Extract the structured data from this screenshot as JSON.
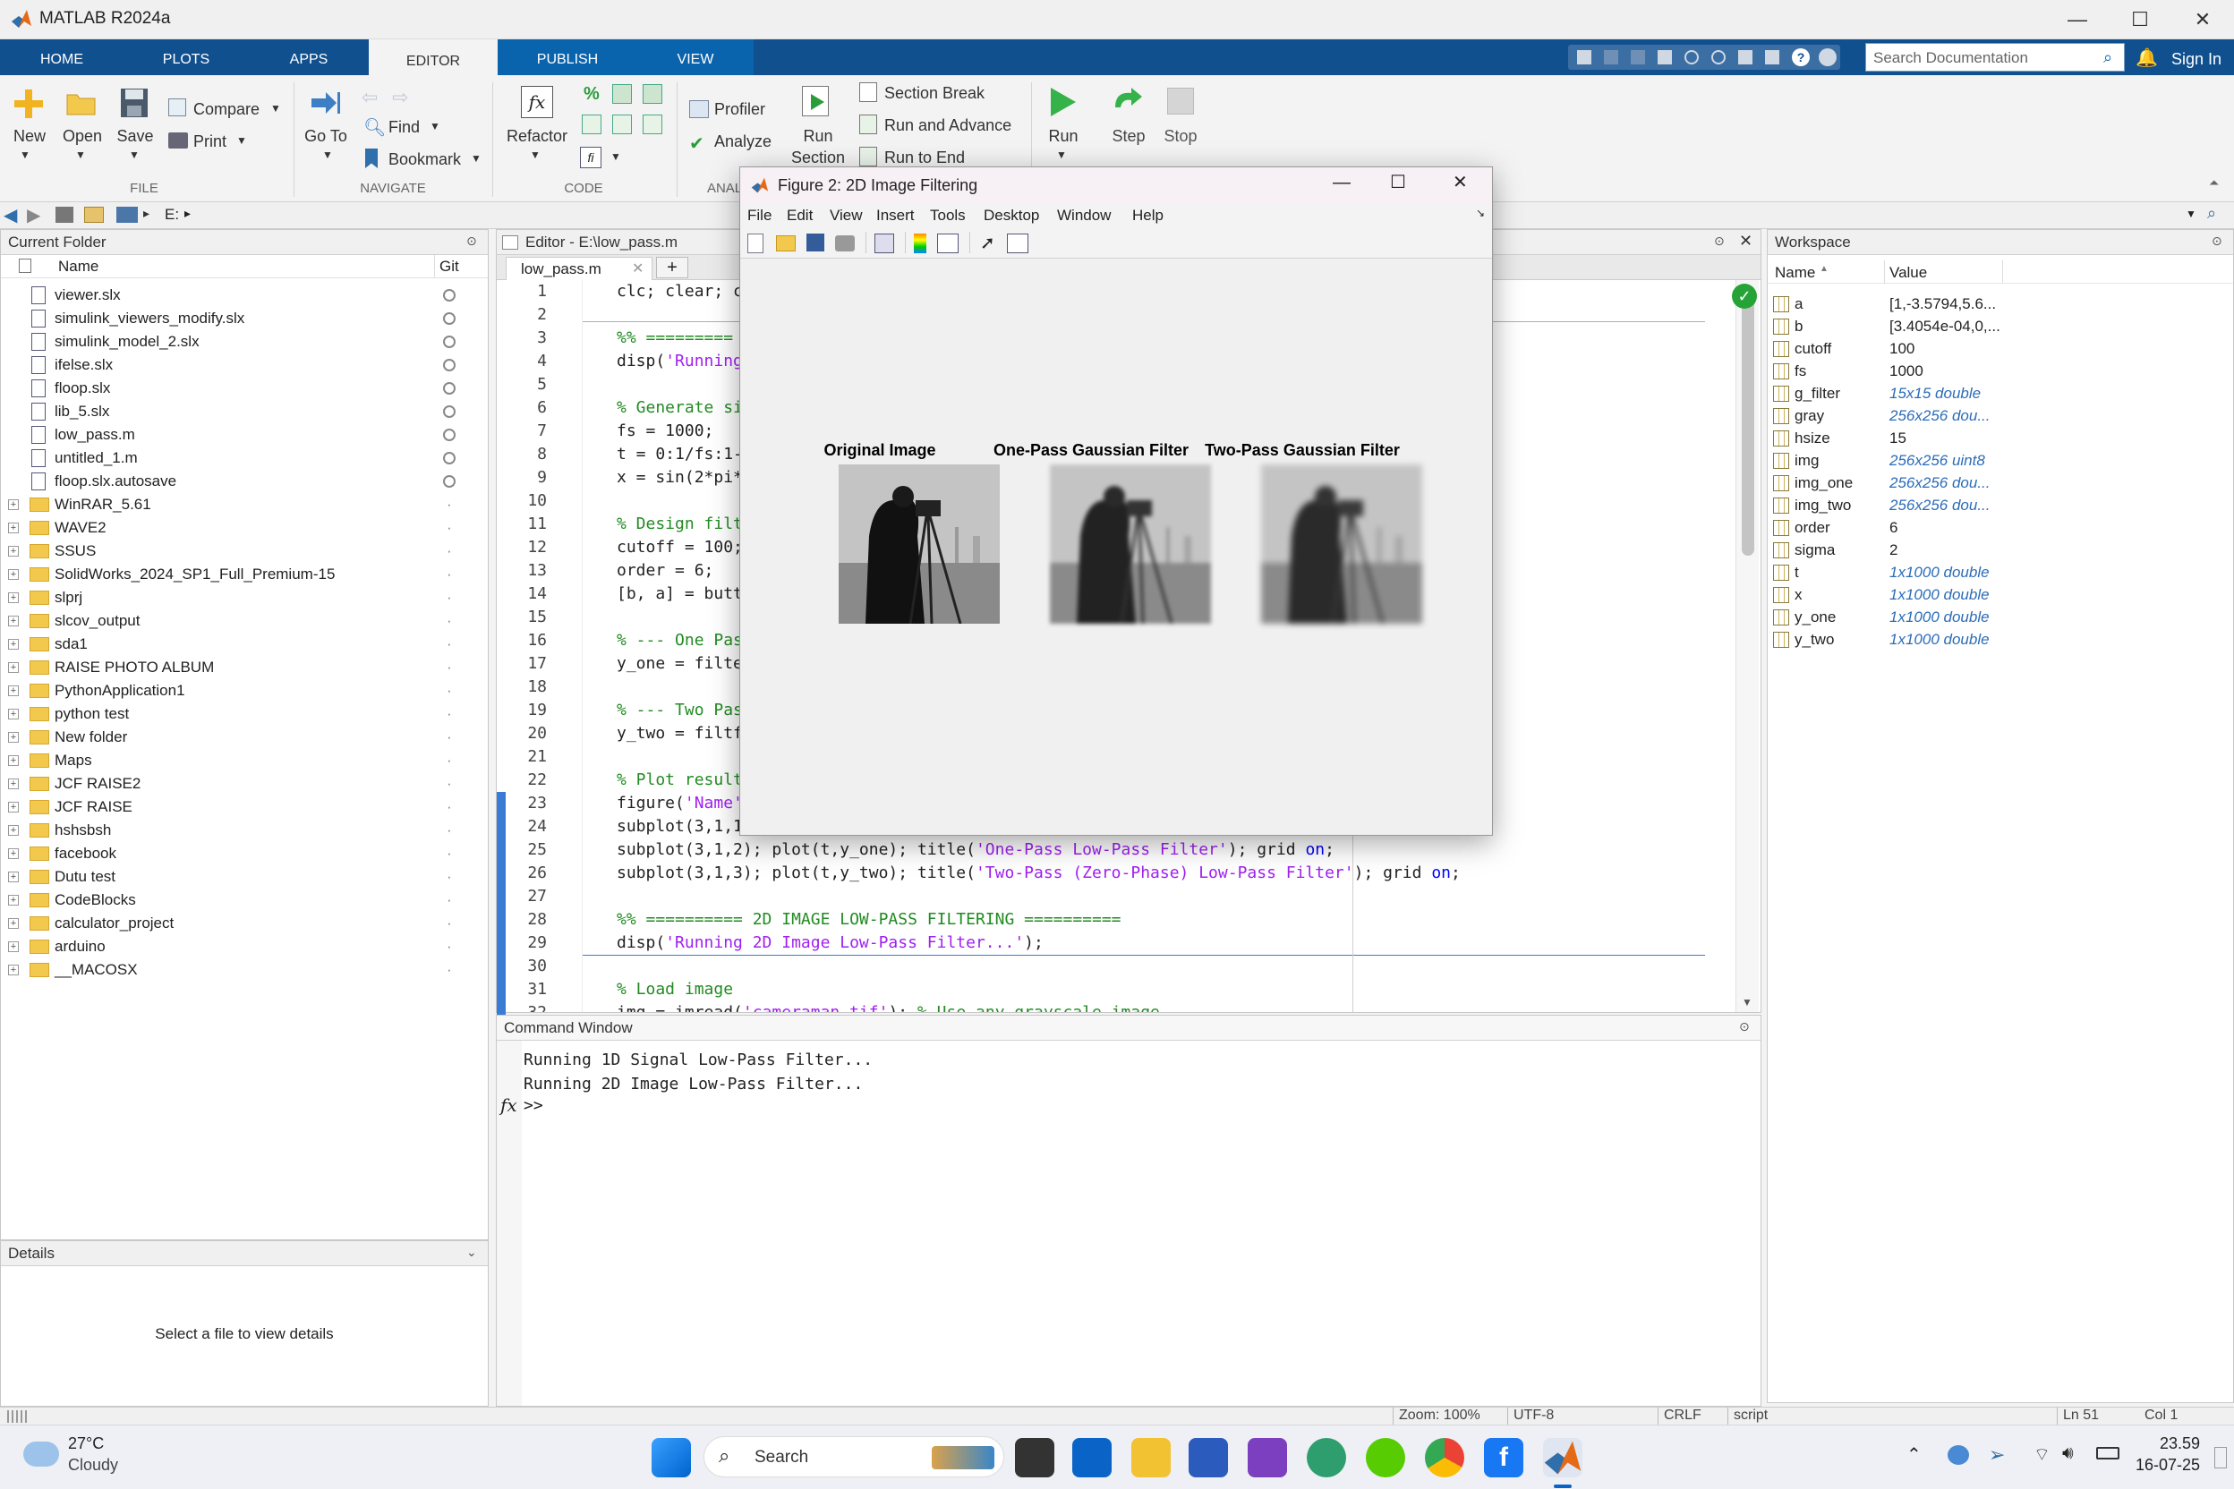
{
  "window": {
    "title": "MATLAB R2024a",
    "minimize": "—",
    "maximize": "☐",
    "close": "✕"
  },
  "tabs": [
    "HOME",
    "PLOTS",
    "APPS",
    "EDITOR",
    "PUBLISH",
    "VIEW"
  ],
  "search_documentation": "Search Documentation",
  "sign_in": "Sign In",
  "ribbon": {
    "file": {
      "new": "New",
      "open": "Open",
      "save": "Save",
      "compare": "Compare",
      "print": "Print",
      "group": "FILE"
    },
    "navigate": {
      "goto": "Go To",
      "find": "Find",
      "bookmark": "Bookmark",
      "group": "NAVIGATE"
    },
    "code": {
      "refactor": "Refactor",
      "group": "CODE"
    },
    "analyze": {
      "profiler": "Profiler",
      "analyze": "Analyze",
      "group": "ANALY"
    },
    "section": {
      "run_section_1": "Run",
      "run_section_2": "Section",
      "section_break": "Section Break",
      "run_advance": "Run and Advance",
      "run_end": "Run to End"
    },
    "run": {
      "run": "Run",
      "step": "Step",
      "stop": "Stop"
    }
  },
  "address": {
    "path": "E:",
    "arrow": "▸"
  },
  "current_folder": {
    "title": "Current Folder",
    "col_name": "Name",
    "col_git": "Git",
    "files": [
      "viewer.slx",
      "simulink_viewers_modify.slx",
      "simulink_model_2.slx",
      "ifelse.slx",
      "floop.slx",
      "lib_5.slx",
      "low_pass.m",
      "untitled_1.m",
      "floop.slx.autosave"
    ],
    "folders": [
      "WinRAR_5.61",
      "WAVE2",
      "SSUS",
      "SolidWorks_2024_SP1_Full_Premium-15",
      "slprj",
      "slcov_output",
      "sda1",
      "RAISE PHOTO ALBUM",
      "PythonApplication1",
      "python test",
      "New folder",
      "Maps",
      "JCF RAISE2",
      "JCF RAISE",
      "hshsbsh",
      "facebook",
      "Dutu test",
      "CodeBlocks",
      "calculator_project",
      "arduino",
      "__MACOSX"
    ],
    "folder_git": "·"
  },
  "details": {
    "title": "Details",
    "message": "Select a file to view details"
  },
  "editor": {
    "title": "Editor - E:\\low_pass.m",
    "tab": "low_pass.m",
    "lines": [
      {
        "n": "1",
        "t": "clc; clear; c",
        "c": ""
      },
      {
        "n": "2",
        "t": "",
        "c": ""
      },
      {
        "n": "3",
        "t": "%% =========",
        "c": "cm"
      },
      {
        "n": "4",
        "t": "disp(",
        "s": "'Running",
        "c": ""
      },
      {
        "n": "5",
        "t": "",
        "c": ""
      },
      {
        "n": "6",
        "t": "% Generate si",
        "c": "cm"
      },
      {
        "n": "7",
        "t": "fs = 1000;",
        "c": ""
      },
      {
        "n": "8",
        "t": "t = 0:1/fs:1-",
        "c": ""
      },
      {
        "n": "9",
        "t": "x = sin(2*pi*",
        "c": ""
      },
      {
        "n": "10",
        "t": "",
        "c": ""
      },
      {
        "n": "11",
        "t": "% Design filt",
        "c": "cm"
      },
      {
        "n": "12",
        "t": "cutoff = 100;",
        "c": ""
      },
      {
        "n": "13",
        "t": "order = 6;",
        "c": ""
      },
      {
        "n": "14",
        "t": "[b, a] = butt",
        "c": ""
      },
      {
        "n": "15",
        "t": "",
        "c": ""
      },
      {
        "n": "16",
        "t": "% --- One Pas",
        "c": "cm"
      },
      {
        "n": "17",
        "t": "y_one = filte",
        "c": ""
      },
      {
        "n": "18",
        "t": "",
        "c": ""
      },
      {
        "n": "19",
        "t": "% --- Two Pas",
        "c": "cm"
      },
      {
        "n": "20",
        "t": "y_two = filtf",
        "c": ""
      },
      {
        "n": "21",
        "t": "",
        "c": ""
      },
      {
        "n": "22",
        "t": "% Plot result",
        "c": "cm"
      },
      {
        "n": "23",
        "t": "figure(",
        "s": "'Name'",
        "c": ""
      },
      {
        "n": "24",
        "t": "subplot(3,1,1",
        "c": ""
      },
      {
        "n": "25",
        "t": "subplot(3,1,2); plot(t,y_one); title(",
        "s": "'One-Pass Low-Pass Filter'",
        "t2": "); grid ",
        "k": "on",
        "t3": ";",
        "c": ""
      },
      {
        "n": "26",
        "t": "subplot(3,1,3); plot(t,y_two); title(",
        "s": "'Two-Pass (Zero-Phase) Low-Pass Filter'",
        "t2": "); grid ",
        "k": "on",
        "t3": ";",
        "c": ""
      },
      {
        "n": "27",
        "t": "",
        "c": ""
      },
      {
        "n": "28",
        "t": "%% ========== 2D IMAGE LOW-PASS FILTERING ==========",
        "c": "cm"
      },
      {
        "n": "29",
        "t": "disp(",
        "s": "'Running 2D Image Low-Pass Filter...'",
        "t2": ");",
        "c": ""
      },
      {
        "n": "30",
        "t": "",
        "c": ""
      },
      {
        "n": "31",
        "t": "% Load image",
        "c": "cm"
      },
      {
        "n": "32",
        "t": "img = imread(",
        "s": "'cameraman.tif'",
        "t2": "); ",
        "cm2": "% Use any grayscale image",
        "c": ""
      }
    ]
  },
  "command_window": {
    "title": "Command Window",
    "lines": [
      "Running 1D Signal Low-Pass Filter...",
      "Running 2D Image Low-Pass Filter..."
    ],
    "fx": "fx",
    "prompt": ">>"
  },
  "workspace": {
    "title": "Workspace",
    "col_name": "Name",
    "col_value": "Value",
    "vars": [
      {
        "name": "a",
        "value": "[1,-3.5794,5.6...",
        "italic": false
      },
      {
        "name": "b",
        "value": "[3.4054e-04,0,...",
        "italic": false
      },
      {
        "name": "cutoff",
        "value": "100",
        "italic": false
      },
      {
        "name": "fs",
        "value": "1000",
        "italic": false
      },
      {
        "name": "g_filter",
        "value": "15x15 double",
        "italic": true
      },
      {
        "name": "gray",
        "value": "256x256 dou...",
        "italic": true
      },
      {
        "name": "hsize",
        "value": "15",
        "italic": false
      },
      {
        "name": "img",
        "value": "256x256 uint8",
        "italic": true
      },
      {
        "name": "img_one",
        "value": "256x256 dou...",
        "italic": true
      },
      {
        "name": "img_two",
        "value": "256x256 dou...",
        "italic": true
      },
      {
        "name": "order",
        "value": "6",
        "italic": false
      },
      {
        "name": "sigma",
        "value": "2",
        "italic": false
      },
      {
        "name": "t",
        "value": "1x1000 double",
        "italic": true
      },
      {
        "name": "x",
        "value": "1x1000 double",
        "italic": true
      },
      {
        "name": "y_one",
        "value": "1x1000 double",
        "italic": true
      },
      {
        "name": "y_two",
        "value": "1x1000 double",
        "italic": true
      }
    ]
  },
  "figure": {
    "title": "Figure 2: 2D Image Filtering",
    "menu": [
      "File",
      "Edit",
      "View",
      "Insert",
      "Tools",
      "Desktop",
      "Window",
      "Help"
    ],
    "subplots": [
      "Original Image",
      "One-Pass Gaussian Filter",
      "Two-Pass Gaussian Filter"
    ]
  },
  "statusbar": {
    "zoom": "Zoom: 100%",
    "encoding": "UTF-8",
    "eol": "CRLF",
    "type": "script",
    "ln": "Ln  51",
    "col": "Col  1"
  },
  "taskbar": {
    "weather_temp": "27°C",
    "weather_desc": "Cloudy",
    "search": "Search",
    "time": "23.59",
    "date": "16-07-25"
  },
  "colors": {
    "ribbon_tab_bg": "#11508f",
    "accent": "#0a64ad",
    "comment": "#228b22",
    "string": "#a020f0",
    "keyword": "#0000ff"
  }
}
